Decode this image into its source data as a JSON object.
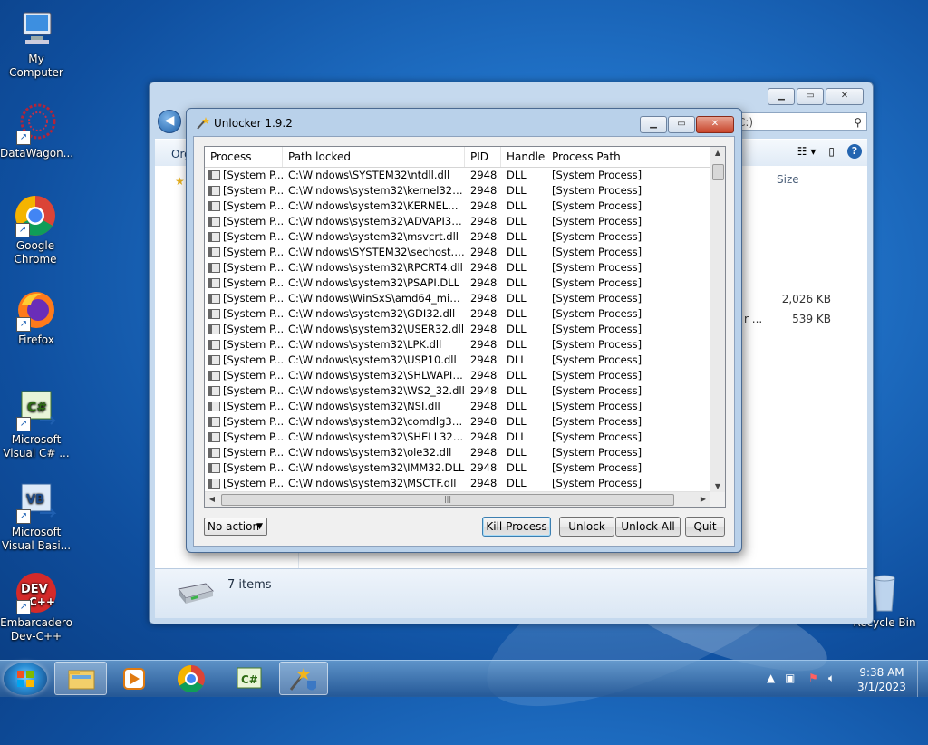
{
  "desktop": {
    "icons": [
      {
        "label": "My Computer"
      },
      {
        "label": "DataWagon..."
      },
      {
        "label": "Google Chrome"
      },
      {
        "label": "Firefox"
      },
      {
        "label": "Microsoft Visual C# ..."
      },
      {
        "label": "Microsoft Visual Basi..."
      },
      {
        "label": "Embarcadero Dev-C++"
      },
      {
        "label": "Recycle Bin"
      }
    ]
  },
  "explorer": {
    "search_placeholder": "C:)",
    "organize_label": "Org",
    "column_size": "Size",
    "sizes": [
      "2,026 KB",
      "539 KB"
    ],
    "truncated_name": "r ...",
    "items_count": "7 items"
  },
  "dialog": {
    "title": "Unlocker 1.9.2",
    "columns": [
      "Process",
      "Path locked",
      "PID",
      "Handle",
      "Process Path"
    ],
    "rows": [
      {
        "process": "[System P...",
        "path": "C:\\Windows\\SYSTEM32\\ntdll.dll",
        "pid": "2948",
        "handle": "DLL",
        "process_path": "[System Process]"
      },
      {
        "process": "[System P...",
        "path": "C:\\Windows\\system32\\kernel32.dll",
        "pid": "2948",
        "handle": "DLL",
        "process_path": "[System Process]"
      },
      {
        "process": "[System P...",
        "path": "C:\\Windows\\system32\\KERNELBASE.dll",
        "pid": "2948",
        "handle": "DLL",
        "process_path": "[System Process]"
      },
      {
        "process": "[System P...",
        "path": "C:\\Windows\\system32\\ADVAPI32.DLL",
        "pid": "2948",
        "handle": "DLL",
        "process_path": "[System Process]"
      },
      {
        "process": "[System P...",
        "path": "C:\\Windows\\system32\\msvcrt.dll",
        "pid": "2948",
        "handle": "DLL",
        "process_path": "[System Process]"
      },
      {
        "process": "[System P...",
        "path": "C:\\Windows\\SYSTEM32\\sechost.dll",
        "pid": "2948",
        "handle": "DLL",
        "process_path": "[System Process]"
      },
      {
        "process": "[System P...",
        "path": "C:\\Windows\\system32\\RPCRT4.dll",
        "pid": "2948",
        "handle": "DLL",
        "process_path": "[System Process]"
      },
      {
        "process": "[System P...",
        "path": "C:\\Windows\\system32\\PSAPI.DLL",
        "pid": "2948",
        "handle": "DLL",
        "process_path": "[System Process]"
      },
      {
        "process": "[System P...",
        "path": "C:\\Windows\\WinSxS\\amd64_microso...",
        "pid": "2948",
        "handle": "DLL",
        "process_path": "[System Process]"
      },
      {
        "process": "[System P...",
        "path": "C:\\Windows\\system32\\GDI32.dll",
        "pid": "2948",
        "handle": "DLL",
        "process_path": "[System Process]"
      },
      {
        "process": "[System P...",
        "path": "C:\\Windows\\system32\\USER32.dll",
        "pid": "2948",
        "handle": "DLL",
        "process_path": "[System Process]"
      },
      {
        "process": "[System P...",
        "path": "C:\\Windows\\system32\\LPK.dll",
        "pid": "2948",
        "handle": "DLL",
        "process_path": "[System Process]"
      },
      {
        "process": "[System P...",
        "path": "C:\\Windows\\system32\\USP10.dll",
        "pid": "2948",
        "handle": "DLL",
        "process_path": "[System Process]"
      },
      {
        "process": "[System P...",
        "path": "C:\\Windows\\system32\\SHLWAPI.dll",
        "pid": "2948",
        "handle": "DLL",
        "process_path": "[System Process]"
      },
      {
        "process": "[System P...",
        "path": "C:\\Windows\\system32\\WS2_32.dll",
        "pid": "2948",
        "handle": "DLL",
        "process_path": "[System Process]"
      },
      {
        "process": "[System P...",
        "path": "C:\\Windows\\system32\\NSI.dll",
        "pid": "2948",
        "handle": "DLL",
        "process_path": "[System Process]"
      },
      {
        "process": "[System P...",
        "path": "C:\\Windows\\system32\\comdlg32.dll",
        "pid": "2948",
        "handle": "DLL",
        "process_path": "[System Process]"
      },
      {
        "process": "[System P...",
        "path": "C:\\Windows\\system32\\SHELL32.dll",
        "pid": "2948",
        "handle": "DLL",
        "process_path": "[System Process]"
      },
      {
        "process": "[System P...",
        "path": "C:\\Windows\\system32\\ole32.dll",
        "pid": "2948",
        "handle": "DLL",
        "process_path": "[System Process]"
      },
      {
        "process": "[System P...",
        "path": "C:\\Windows\\system32\\IMM32.DLL",
        "pid": "2948",
        "handle": "DLL",
        "process_path": "[System Process]"
      },
      {
        "process": "[System P...",
        "path": "C:\\Windows\\system32\\MSCTF.dll",
        "pid": "2948",
        "handle": "DLL",
        "process_path": "[System Process]"
      }
    ],
    "action_select": "No action",
    "buttons": {
      "kill": "Kill Process",
      "unlock": "Unlock",
      "unlock_all": "Unlock All",
      "quit": "Quit"
    }
  },
  "taskbar": {
    "clock_time": "9:38 AM",
    "clock_date": "3/1/2023"
  }
}
